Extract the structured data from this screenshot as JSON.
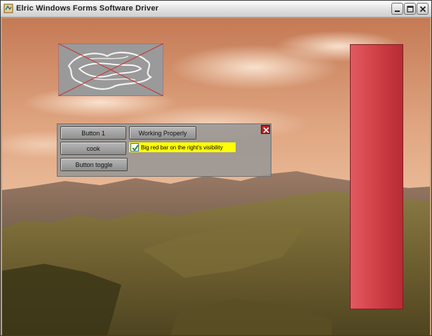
{
  "window": {
    "title": "Elric Windows Forms Software Driver",
    "icons": {
      "app": "app-icon",
      "minimize": "minimize-icon",
      "maximize": "maximize-icon",
      "close": "close-icon"
    }
  },
  "panel": {
    "buttons": {
      "button1": "Button 1",
      "cook": "cook",
      "toggle": "Button toggle",
      "working": "Working Properly"
    },
    "checkbox": {
      "label": "Big red bar on the right's visibility",
      "checked": true
    },
    "close_icon": "close-icon"
  },
  "scene": {
    "texture_icon": "crossed-out-texture-icon",
    "red_bar": "red-bar"
  },
  "colors": {
    "bar": "#d94a50",
    "checkbox_bg": "#ffff00",
    "close": "#b22020"
  }
}
